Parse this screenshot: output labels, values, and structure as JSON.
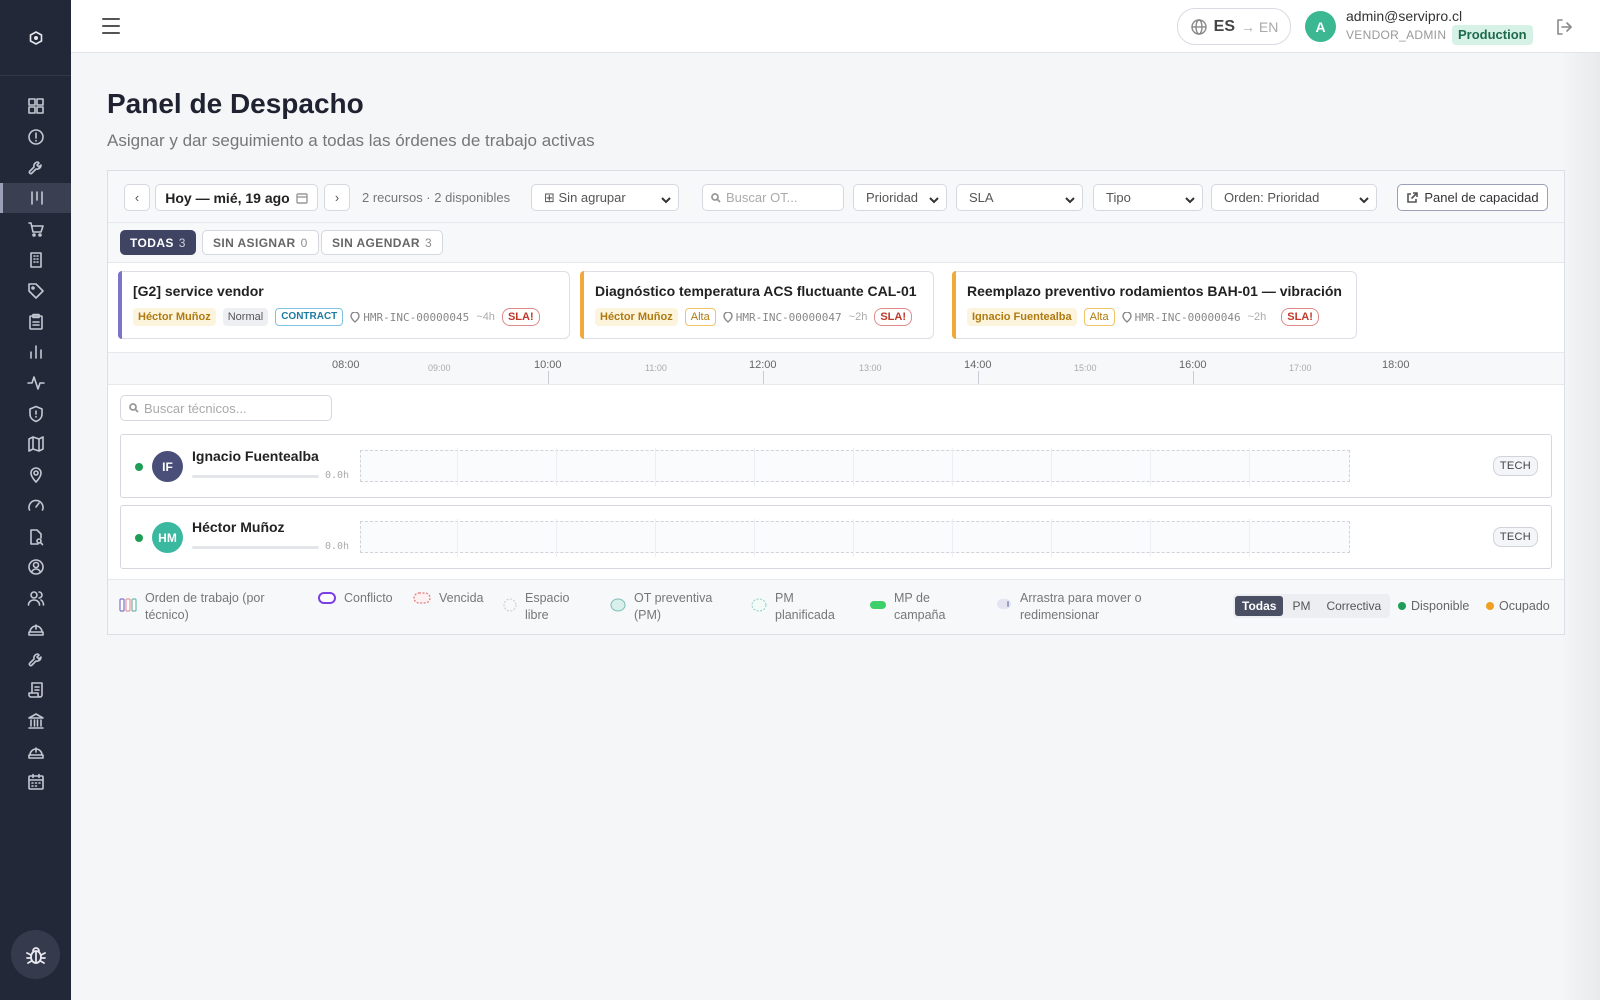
{
  "header": {
    "lang_current": "ES",
    "lang_target": "→ EN",
    "user_initial": "A",
    "user_email": "admin@servipro.cl",
    "user_role": "VENDOR_ADMIN",
    "environment": "Production"
  },
  "sidebar": {
    "items": [
      {
        "icon": "dashboard-icon"
      },
      {
        "icon": "alert-icon"
      },
      {
        "icon": "wrench-icon"
      },
      {
        "icon": "dispatch-icon",
        "active": true
      },
      {
        "icon": "cart-icon"
      },
      {
        "icon": "building-icon"
      },
      {
        "icon": "tag-icon"
      },
      {
        "icon": "clipboard-icon"
      },
      {
        "icon": "bar-chart-icon"
      },
      {
        "icon": "activity-icon"
      },
      {
        "icon": "shield-icon"
      },
      {
        "icon": "map-icon"
      },
      {
        "icon": "location-pin-icon"
      },
      {
        "icon": "gauge-icon"
      },
      {
        "icon": "file-search-icon"
      },
      {
        "icon": "user-circle-icon"
      },
      {
        "icon": "users-icon"
      },
      {
        "icon": "hard-hat-icon"
      },
      {
        "icon": "wrench-icon"
      },
      {
        "icon": "scroll-icon"
      },
      {
        "icon": "bank-icon"
      },
      {
        "icon": "hard-hat-icon"
      },
      {
        "icon": "calendar-icon"
      }
    ]
  },
  "page": {
    "title": "Panel de Despacho",
    "subtitle": "Asignar y dar seguimiento a todas las órdenes de trabajo activas"
  },
  "toolbar": {
    "prev": "‹",
    "next": "›",
    "date_label": "Hoy — mié, 19 ago",
    "resources_info": "2 recursos · 2 disponibles",
    "group_select": "⊞ Sin agrupar",
    "search_placeholder": "Buscar OT...",
    "priority_select": "Prioridad",
    "sla_select": "SLA",
    "type_select": "Tipo",
    "order_select": "Orden: Prioridad",
    "capacity_button": "Panel de capacidad"
  },
  "filters": [
    {
      "label": "TODAS",
      "count": "3",
      "active": true
    },
    {
      "label": "SIN ASIGNAR",
      "count": "0",
      "active": false
    },
    {
      "label": "SIN AGENDAR",
      "count": "3",
      "active": false
    }
  ],
  "work_orders": [
    {
      "title": "[G2] service vendor",
      "assignee": "Héctor Muñoz",
      "priority": "Normal",
      "contract": "CONTRACT",
      "code": "HMR-INC-00000045",
      "duration": "~4h",
      "sla": "SLA!",
      "accent": "#7b74c9"
    },
    {
      "title": "Diagnóstico temperatura ACS fluctuante CAL-01",
      "assignee": "Héctor Muñoz",
      "priority": "Alta",
      "code": "HMR-INC-00000047",
      "duration": "~2h",
      "sla": "SLA!",
      "accent": "#f0a93b"
    },
    {
      "title": "Reemplazo preventivo rodamientos BAH-01 — vibración",
      "assignee": "Ignacio Fuentealba",
      "priority": "Alta",
      "code": "HMR-INC-00000046",
      "duration": "~2h",
      "sla": "SLA!",
      "accent": "#f0a93b"
    }
  ],
  "timeline": {
    "major": [
      "08:00",
      "10:00",
      "12:00",
      "14:00",
      "16:00",
      "18:00"
    ],
    "minor": [
      "09:00",
      "11:00",
      "13:00",
      "15:00",
      "17:00"
    ]
  },
  "tech_search_placeholder": "Buscar técnicos...",
  "technicians": [
    {
      "initials": "IF",
      "name": "Ignacio Fuentealba",
      "hours": "0.0h",
      "load": 0,
      "role": "TECH",
      "avatar_color": "#4a4f7a",
      "status": "available"
    },
    {
      "initials": "HM",
      "name": "Héctor Muñoz",
      "hours": "0.0h",
      "load": 0,
      "role": "TECH",
      "avatar_color": "#3bb8a0",
      "status": "available"
    }
  ],
  "legend": {
    "work_order": "Orden de trabajo (por técnico)",
    "conflict": "Conflicto",
    "overdue": "Vencida",
    "free_slot": "Espacio libre",
    "preventive": "OT preventiva (PM)",
    "pm_planned": "PM planificada",
    "campaign": "MP de campaña",
    "drag_hint": "Arrastra para mover o redimensionar",
    "seg_all": "Todas",
    "seg_pm": "PM",
    "seg_corrective": "Correctiva",
    "available": "Disponible",
    "busy": "Ocupado"
  },
  "colors": {
    "sidebar_bg": "#232838",
    "available": "#1f9d55",
    "busy": "#f0a020",
    "sla": "#c0392b"
  }
}
